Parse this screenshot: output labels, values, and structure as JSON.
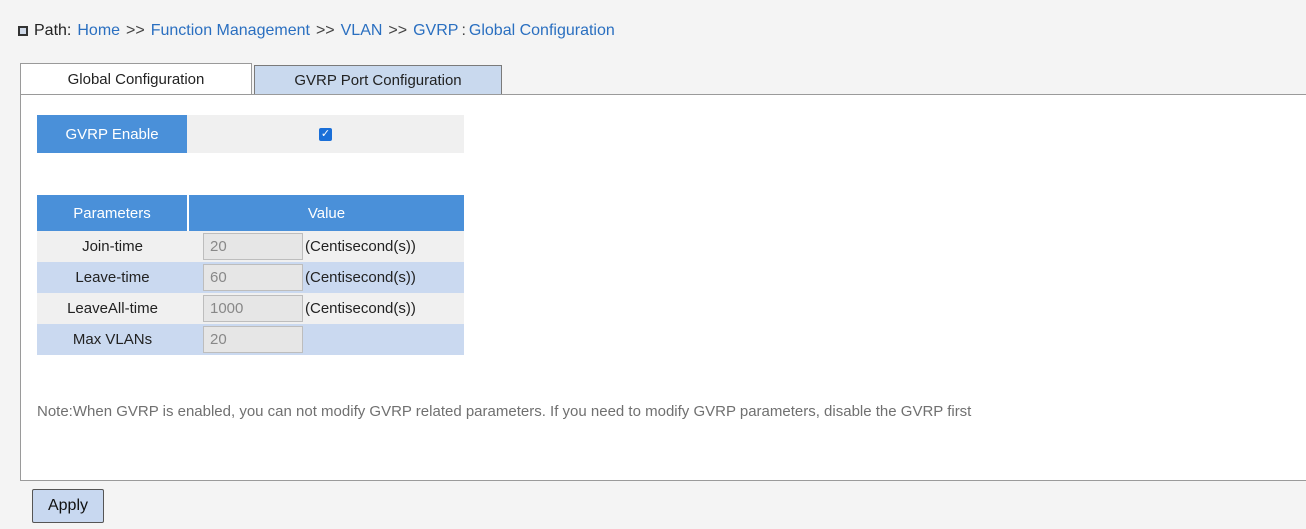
{
  "path": {
    "label": "Path:",
    "crumbs": [
      "Home",
      "Function Management",
      "VLAN",
      "GVRP",
      "Global Configuration"
    ],
    "separators": [
      ">>",
      ">>",
      ">>",
      ":"
    ]
  },
  "tabs": [
    {
      "label": "Global Configuration",
      "active": true
    },
    {
      "label": "GVRP Port Configuration",
      "active": false
    }
  ],
  "gvrp_enable": {
    "label": "GVRP Enable",
    "checked": true,
    "check_glyph": "✓"
  },
  "params_table": {
    "headers": [
      "Parameters",
      "Value"
    ],
    "rows": [
      {
        "name": "Join-time",
        "value": "20",
        "unit": "(Centisecond(s))"
      },
      {
        "name": "Leave-time",
        "value": "60",
        "unit": "(Centisecond(s))"
      },
      {
        "name": "LeaveAll-time",
        "value": "1000",
        "unit": "(Centisecond(s))"
      },
      {
        "name": "Max VLANs",
        "value": "20",
        "unit": ""
      }
    ]
  },
  "note": "Note:When GVRP is enabled, you can not modify GVRP related parameters. If you need to modify GVRP parameters, disable the GVRP first",
  "apply_label": "Apply",
  "colors": {
    "header_blue": "#4a90d9",
    "row_alt": "#cad9f0",
    "link": "#2a6fc0",
    "button": "#c8d8f0"
  }
}
